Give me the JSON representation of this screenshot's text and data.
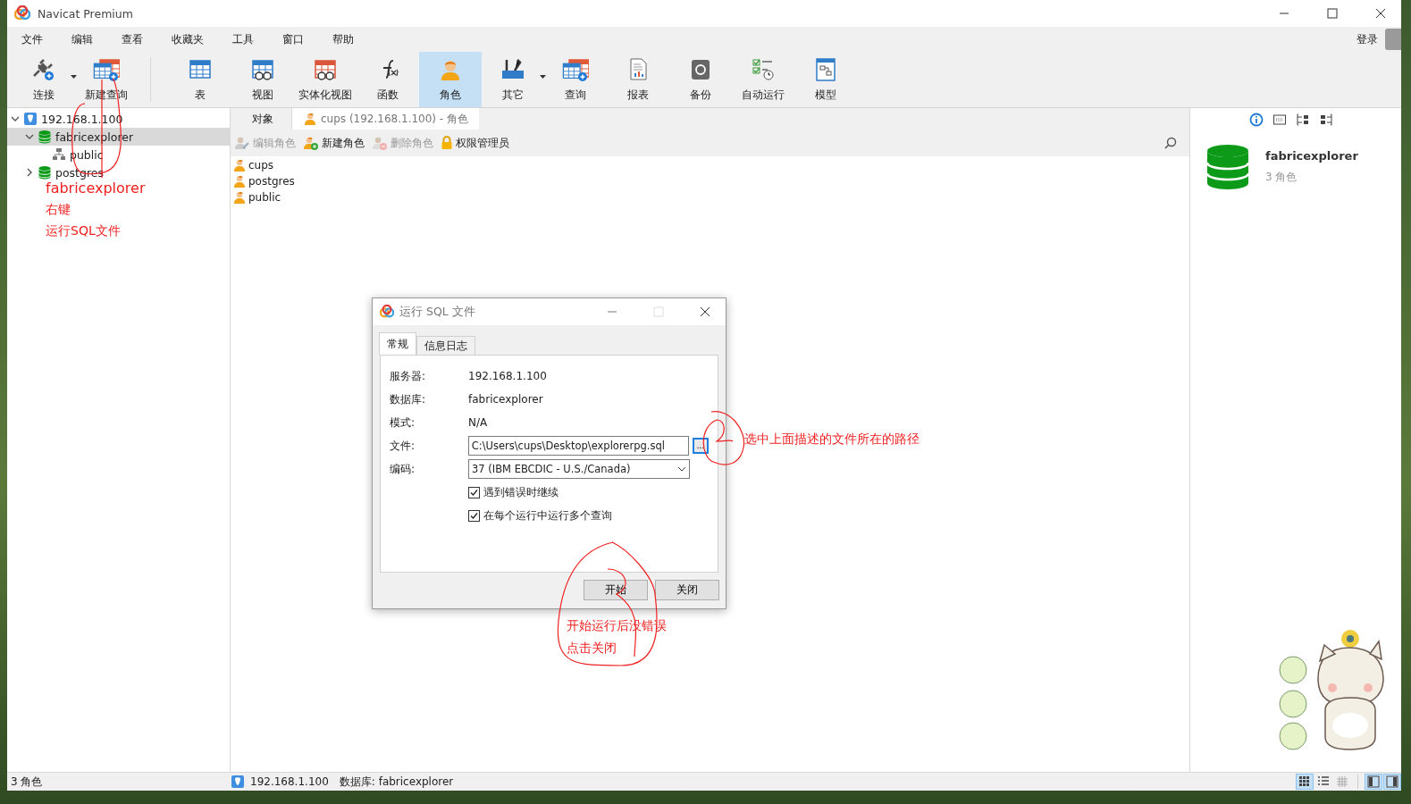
{
  "window": {
    "title": "Navicat Premium"
  },
  "menu": [
    "文件",
    "编辑",
    "查看",
    "收藏夹",
    "工具",
    "窗口",
    "帮助"
  ],
  "account": {
    "label": "登录"
  },
  "toolbar": [
    {
      "label": "连接",
      "kind": "connect",
      "dropdown": true,
      "selected": false
    },
    {
      "label": "新建查询",
      "kind": "query",
      "dropdown": false,
      "selected": false
    },
    {
      "label": "表",
      "kind": "table",
      "dropdown": false,
      "selected": false
    },
    {
      "label": "视图",
      "kind": "view",
      "dropdown": false,
      "selected": false
    },
    {
      "label": "实体化视图",
      "kind": "matview",
      "dropdown": false,
      "selected": false
    },
    {
      "label": "函数",
      "kind": "function",
      "dropdown": false,
      "selected": false
    },
    {
      "label": "角色",
      "kind": "role",
      "dropdown": false,
      "selected": true
    },
    {
      "label": "其它",
      "kind": "other",
      "dropdown": true,
      "selected": false
    },
    {
      "label": "查询",
      "kind": "query",
      "dropdown": false,
      "selected": false
    },
    {
      "label": "报表",
      "kind": "report",
      "dropdown": false,
      "selected": false
    },
    {
      "label": "备份",
      "kind": "backup",
      "dropdown": false,
      "selected": false
    },
    {
      "label": "自动运行",
      "kind": "autorun",
      "dropdown": false,
      "selected": false
    },
    {
      "label": "模型",
      "kind": "model",
      "dropdown": false,
      "selected": false
    }
  ],
  "tree": [
    {
      "label": "192.168.1.100",
      "kind": "server",
      "expanded": true,
      "selected": false,
      "children": [
        {
          "label": "fabricexplorer",
          "kind": "database",
          "expanded": true,
          "selected": true,
          "children": [
            {
              "label": "public",
              "kind": "schema",
              "selected": false
            }
          ]
        },
        {
          "label": "postgres",
          "kind": "database",
          "expanded": false,
          "selected": false
        }
      ]
    }
  ],
  "tabs": [
    {
      "label": "对象",
      "selected": true
    },
    {
      "label": "cups (192.168.1.100) - 角色",
      "selected": false
    }
  ],
  "actions": [
    {
      "label": "编辑角色",
      "kind": "edit",
      "disabled": true
    },
    {
      "label": "新建角色",
      "kind": "new",
      "disabled": false
    },
    {
      "label": "删除角色",
      "kind": "delete",
      "disabled": true
    },
    {
      "label": "权限管理员",
      "kind": "lock",
      "disabled": false
    }
  ],
  "roles": [
    "cups",
    "postgres",
    "public"
  ],
  "info": {
    "title": "fabricexplorer",
    "subtitle": "3 角色",
    "tabs": [
      {
        "kind": "info",
        "selected": true
      },
      {
        "kind": "ddl",
        "selected": false
      },
      {
        "kind": "deps",
        "selected": false
      },
      {
        "kind": "refs",
        "selected": false
      }
    ]
  },
  "dialog": {
    "title": "运行 SQL 文件",
    "tabs": [
      {
        "label": "常规",
        "selected": true
      },
      {
        "label": "信息日志",
        "selected": false
      }
    ],
    "fields": [
      {
        "label": "服务器:",
        "value": "192.168.1.100",
        "kind": "text"
      },
      {
        "label": "数据库:",
        "value": "fabricexplorer",
        "kind": "text"
      },
      {
        "label": "模式:",
        "value": "N/A",
        "kind": "text"
      },
      {
        "label": "文件:",
        "value": "C:\\Users\\cups\\Desktop\\explorerpg.sql",
        "kind": "file",
        "button": "..."
      },
      {
        "label": "编码:",
        "value": "37 (IBM EBCDIC - U.S./Canada)",
        "kind": "select"
      }
    ],
    "options": [
      {
        "label": "遇到错误时继续",
        "checked": true
      },
      {
        "label": "在每个运行中运行多个查询",
        "checked": true
      }
    ],
    "buttons": [
      "开始",
      "关闭"
    ]
  },
  "annotations": [
    "fabricexplorer",
    "右键",
    "运行SQL文件",
    "选中上面描述的文件所在的路径",
    "开始运行后没错误",
    "点击关闭"
  ],
  "sticker": {
    "kind": "picture"
  },
  "status_bar": {
    "count": "3 角色",
    "connection": "192.168.1.100",
    "database": "数据库: fabricexplorer",
    "views": [
      {
        "kind": "grid",
        "selected": true
      },
      {
        "kind": "list",
        "selected": false
      },
      {
        "kind": "detail",
        "selected": false
      }
    ],
    "panels": [
      {
        "kind": "left",
        "selected": true
      },
      {
        "kind": "right",
        "selected": true
      }
    ]
  }
}
